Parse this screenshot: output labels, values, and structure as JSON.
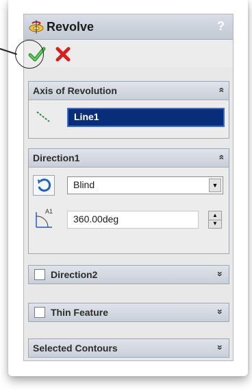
{
  "title": "Revolve",
  "help_glyph": "?",
  "accent_colors": {
    "ok": "#2f9e2f",
    "cancel": "#d61f1f",
    "selection": "#0a2d7a"
  },
  "icons": {
    "revolve": "revolve-feature-icon",
    "ok": "checkmark-icon",
    "cancel": "x-icon",
    "axis": "axis-line-icon",
    "direction": "reverse-direction-icon",
    "angle": "angle-dimension-icon",
    "help": "help-icon"
  },
  "axis_group": {
    "label": "Axis of Revolution",
    "chevron": "»",
    "field_value": "Line1"
  },
  "direction1_group": {
    "label": "Direction1",
    "chevron": "»",
    "end_condition": "Blind",
    "dropdown_arrow": "▼",
    "angle_value": "360.00deg",
    "spin_up": "▲",
    "spin_down": "▼",
    "angle_icon_label": "A1"
  },
  "direction2_group": {
    "label": "Direction2",
    "chevron": "»"
  },
  "thin_feature_group": {
    "label": "Thin Feature",
    "chevron": "»"
  },
  "selected_contours_group": {
    "label": "Selected Contours",
    "chevron": "»"
  }
}
